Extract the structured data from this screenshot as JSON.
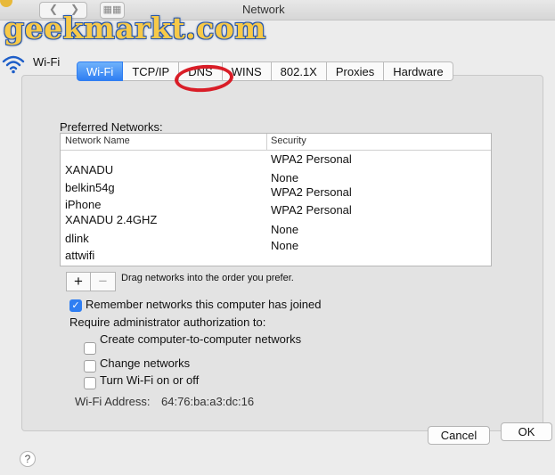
{
  "window": {
    "title": "Network"
  },
  "watermark": {
    "text": "geekmarkt.com"
  },
  "header": {
    "interface_label": "Wi-Fi"
  },
  "tabs": [
    {
      "label": "Wi-Fi",
      "active": true
    },
    {
      "label": "TCP/IP"
    },
    {
      "label": "DNS",
      "highlighted": true
    },
    {
      "label": "WINS"
    },
    {
      "label": "802.1X"
    },
    {
      "label": "Proxies"
    },
    {
      "label": "Hardware"
    }
  ],
  "preferred_networks": {
    "label": "Preferred Networks:",
    "columns": [
      "Network Name",
      "Security"
    ],
    "rows": [
      {
        "name": "XANADU",
        "security": "WPA2 Personal"
      },
      {
        "name": "belkin54g",
        "security": "None"
      },
      {
        "name": "iPhone",
        "security": "WPA2 Personal"
      },
      {
        "name": "XANADU 2.4GHZ",
        "security": "WPA2 Personal"
      },
      {
        "name": "dlink",
        "security": "None"
      },
      {
        "name": "attwifi",
        "security": "None"
      }
    ],
    "add_label": "+",
    "remove_label": "−",
    "drag_hint": "Drag networks into the order you prefer."
  },
  "options": {
    "remember_label": "Remember networks this computer has joined",
    "remember_checked": true,
    "require_admin_label": "Require administrator authorization to:",
    "admin_items": [
      {
        "label": "Create computer-to-computer networks",
        "checked": false
      },
      {
        "label": "Change networks",
        "checked": false
      },
      {
        "label": "Turn Wi-Fi on or off",
        "checked": false
      }
    ]
  },
  "wifi_address": {
    "label": "Wi-Fi Address:",
    "value": "64:76:ba:a3:dc:16"
  },
  "buttons": {
    "cancel": "Cancel",
    "ok": "OK",
    "help": "?"
  },
  "colors": {
    "accent": "#2f7ef2",
    "highlight_circle": "#d91d27",
    "watermark": "#2a57a8"
  },
  "icons": {
    "header": "wifi-icon",
    "help": "help-icon"
  }
}
